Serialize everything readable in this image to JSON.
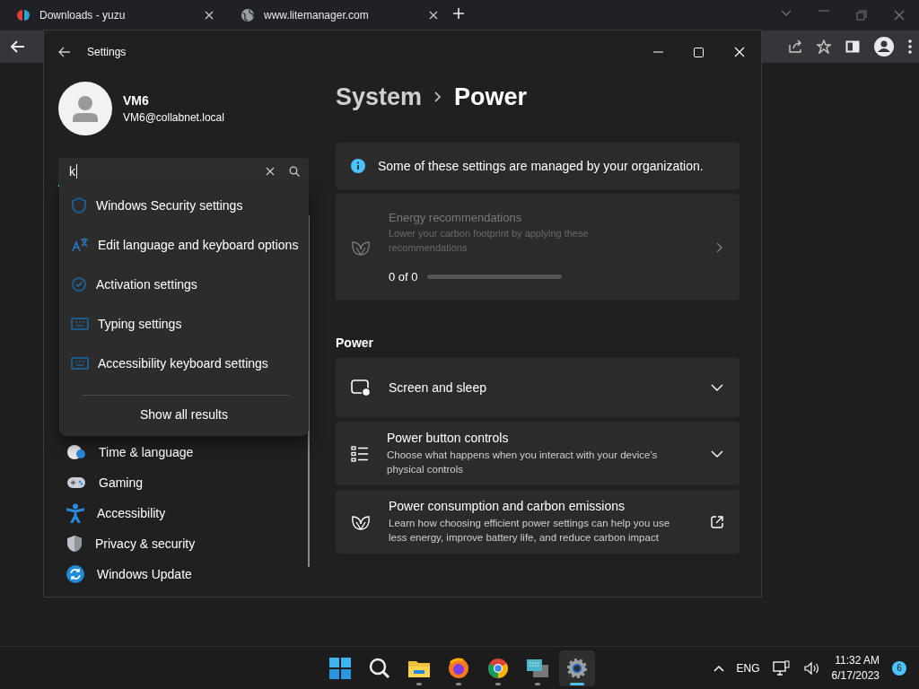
{
  "browser": {
    "tabs": [
      {
        "title": "Downloads - yuzu",
        "kind": "yuzu"
      },
      {
        "title": "www.litemanager.com",
        "kind": "globe"
      }
    ]
  },
  "settings_window": {
    "title": "Settings",
    "user": {
      "name": "VM6",
      "email": "VM6@collabnet.local"
    },
    "search": {
      "value": "k"
    },
    "suggestions": [
      {
        "label": "Windows Security settings",
        "kind": "shield"
      },
      {
        "label": "Edit language and keyboard options",
        "kind": "language"
      },
      {
        "label": "Activation settings",
        "kind": "activation"
      },
      {
        "label": "Typing settings",
        "kind": "keyboard"
      },
      {
        "label": "Accessibility keyboard settings",
        "kind": "keyboard"
      }
    ],
    "show_all": "Show all results",
    "nav": [
      {
        "label": "Time & language",
        "kind": "time"
      },
      {
        "label": "Gaming",
        "kind": "gaming"
      },
      {
        "label": "Accessibility",
        "kind": "accessibility"
      },
      {
        "label": "Privacy & security",
        "kind": "privacy"
      },
      {
        "label": "Windows Update",
        "kind": "update"
      }
    ],
    "breadcrumb": [
      "System",
      "Power"
    ],
    "info": "Some of these settings are managed by your organization.",
    "energy": {
      "title": "Energy recommendations",
      "description": "Lower your carbon footprint by applying these recommendations",
      "progress_text": "0 of 0",
      "level": 0,
      "disabled": true
    },
    "section": "Power",
    "cards": [
      {
        "kind": "expander",
        "title": "Screen and sleep"
      },
      {
        "kind": "expander",
        "title": "Power button controls",
        "description": "Choose what happens when you interact with your device's physical controls"
      },
      {
        "kind": "link",
        "title": "Power consumption and carbon emissions",
        "description": "Learn how choosing efficient power settings can help you use less energy, improve battery life, and reduce carbon impact"
      }
    ]
  },
  "taskbar": {
    "apps": [
      {
        "kind": "start",
        "active": false
      },
      {
        "kind": "search",
        "active": false
      },
      {
        "kind": "explorer",
        "active": false
      },
      {
        "kind": "firefox",
        "active": false
      },
      {
        "kind": "chrome",
        "active": false
      },
      {
        "kind": "remote",
        "active": false
      },
      {
        "kind": "settings",
        "active": true
      }
    ],
    "language": "ENG",
    "time": "11:32 AM",
    "date": "6/17/2023",
    "notifications": "6"
  }
}
